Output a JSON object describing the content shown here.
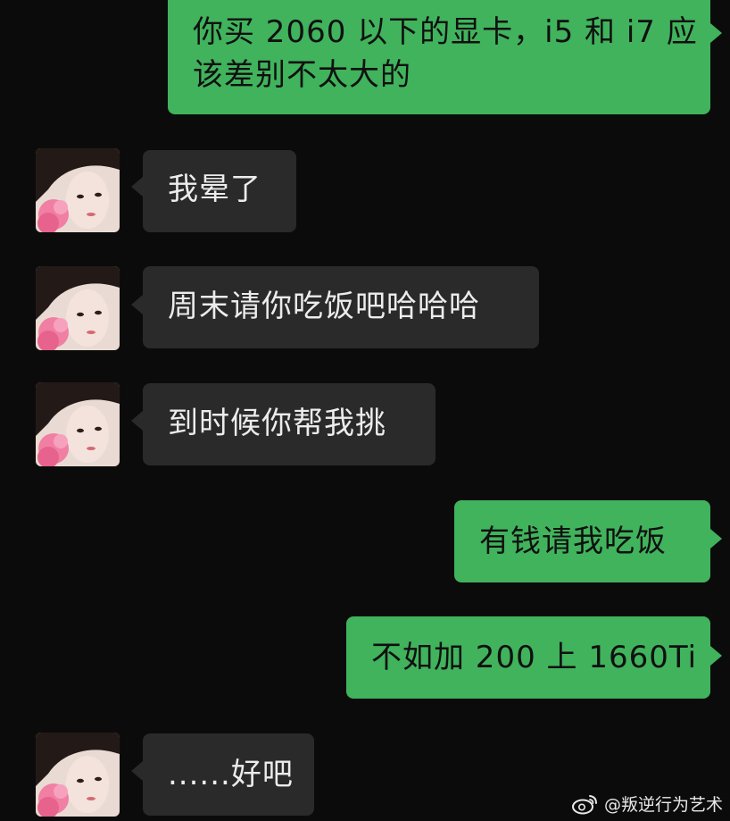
{
  "messages": [
    {
      "sender": "me",
      "text": "你买 2060 以下的显卡，i5 和 i7 应该差别不太大的"
    },
    {
      "sender": "other",
      "text": "我晕了"
    },
    {
      "sender": "other",
      "text": "周末请你吃饭吧哈哈哈"
    },
    {
      "sender": "other",
      "text": "到时候你帮我挑"
    },
    {
      "sender": "me",
      "text": "有钱请我吃饭"
    },
    {
      "sender": "me",
      "text": "不如加 200 上 1660Ti"
    },
    {
      "sender": "other",
      "text": "......好吧"
    }
  ],
  "msg0_line1": "你买 2060 以下的显卡，i5 和 i7 应",
  "msg0_line2": "该差别不太大的",
  "watermark": {
    "icon": "weibo-logo-icon",
    "text": "@叛逆行为艺术"
  },
  "colors": {
    "background": "#0b0b0b",
    "outgoing_bubble": "#40b35c",
    "incoming_bubble": "#2a2a2a"
  }
}
